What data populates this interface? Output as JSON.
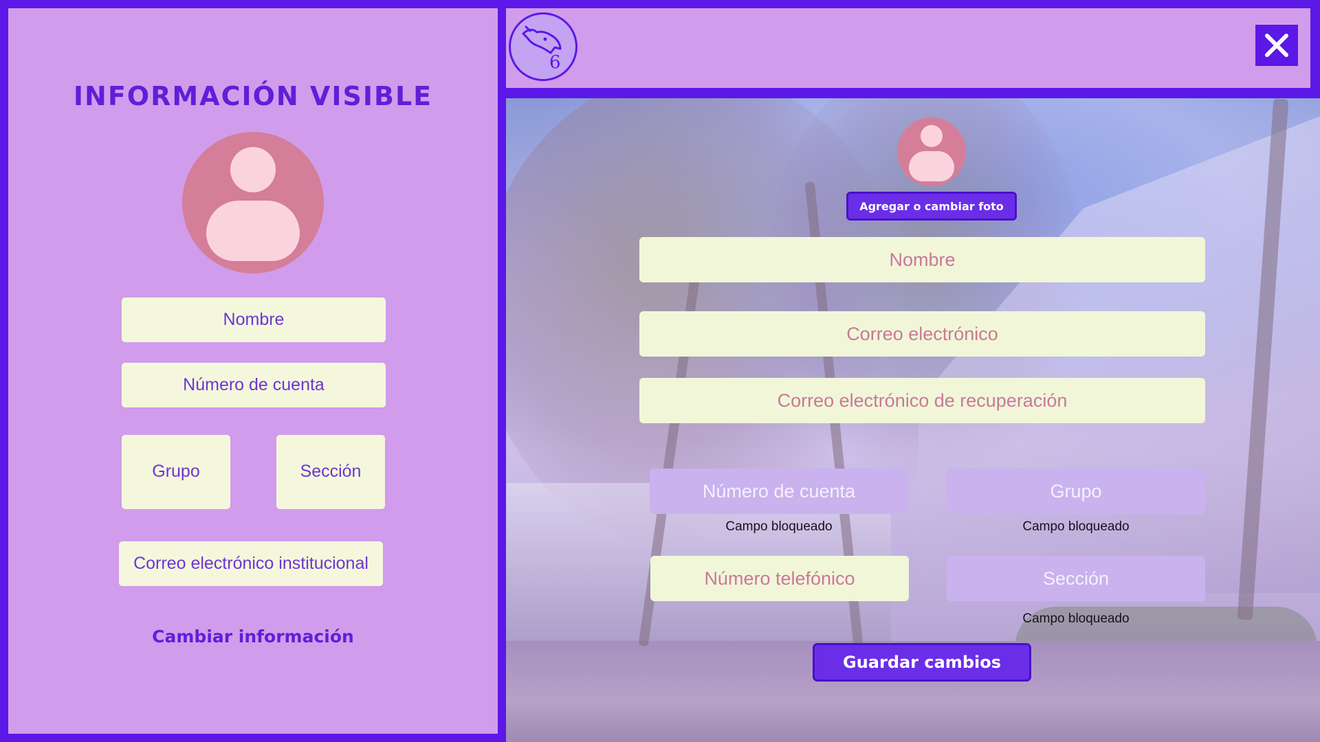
{
  "visible_panel": {
    "title": "INFORMACIÓN VISIBLE",
    "fields": {
      "name": "Nombre",
      "account_number": "Número de cuenta",
      "group": "Grupo",
      "section": "Sección",
      "institutional_email": "Correo electrónico institucional"
    },
    "change_link": "Cambiar información"
  },
  "edit_panel": {
    "photo_button": "Agregar o cambiar foto",
    "inputs": {
      "name_placeholder": "Nombre",
      "email_placeholder": "Correo electrónico",
      "recovery_email_placeholder": "Correo electrónico de recuperación",
      "phone_placeholder": "Número telefónico"
    },
    "locked": {
      "account_number": "Número de cuenta",
      "group": "Grupo",
      "section": "Sección",
      "note": "Campo bloqueado"
    },
    "save_button": "Guardar cambios"
  },
  "colors": {
    "frame": "#5b18e6",
    "panel": "#d19ceb",
    "field": "#f5f7dd",
    "locked_field": "#c9b2ee",
    "avatar": "#d47e9a",
    "accent_text": "#5e1fd8"
  },
  "icons": {
    "logo": "wolf-logo-icon",
    "close": "close-icon",
    "avatar": "user-avatar-icon"
  }
}
